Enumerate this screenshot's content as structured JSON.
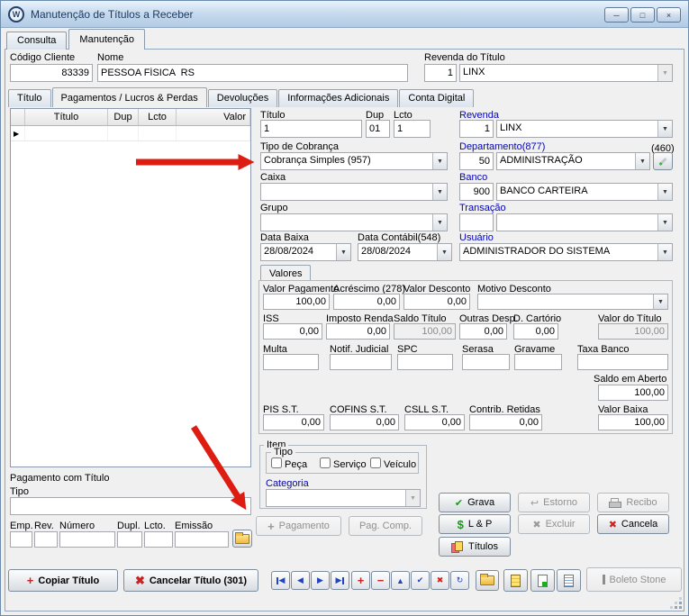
{
  "window": {
    "title": "Manutenção de Títulos a Receber"
  },
  "icons": {
    "app": "W",
    "minimize": "─",
    "maximize": "□",
    "close": "×",
    "dropdown": "▼",
    "row_marker": "▶",
    "check": "✔",
    "cross": "✖",
    "dollar": "$",
    "plus": "+",
    "minus": "−",
    "undo": "↩",
    "refresh": "↻",
    "edit_triangle": "▲",
    "nav_prev": "◀",
    "nav_next": "▶"
  },
  "main_tabs": {
    "consulta": "Consulta",
    "manutencao": "Manutenção"
  },
  "header": {
    "codigo_cliente": {
      "label": "Código Cliente",
      "value": "83339"
    },
    "nome": {
      "label": "Nome",
      "value": "PESSOA FÍSICA  RS"
    },
    "revenda_titulo": {
      "label": "Revenda do Título",
      "num": "1",
      "name": "LINX"
    }
  },
  "sub_tabs": {
    "titulo": "Título",
    "pagamentos": "Pagamentos / Lucros & Perdas",
    "devolucoes": "Devoluções",
    "informacoes": "Informações Adicionais",
    "conta_digital": "Conta Digital"
  },
  "grid": {
    "columns": {
      "titulo": "Título",
      "dup": "Dup",
      "lcto": "Lcto",
      "valor": "Valor"
    }
  },
  "detail": {
    "titulo": {
      "label": "Título",
      "value": "1"
    },
    "dup": {
      "label": "Dup",
      "value": "01"
    },
    "lcto": {
      "label": "Lcto",
      "value": "1"
    },
    "revenda": {
      "label": "Revenda",
      "num": "1",
      "name": "LINX"
    },
    "tipo_cobranca": {
      "label": "Tipo de Cobrança",
      "value": "Cobrança Simples (957)"
    },
    "departamento": {
      "label": "Departamento(877)",
      "note": "(460)",
      "num": "50",
      "name": "ADMINISTRAÇÃO"
    },
    "caixa": {
      "label": "Caixa",
      "value": ""
    },
    "banco": {
      "label": "Banco",
      "num": "900",
      "name": "BANCO CARTEIRA"
    },
    "grupo": {
      "label": "Grupo",
      "value": ""
    },
    "transacao": {
      "label": "Transação",
      "num": "",
      "name": ""
    },
    "data_baixa": {
      "label": "Data Baixa",
      "value": "28/08/2024"
    },
    "data_contabil": {
      "label": "Data Contábil(548)",
      "value": "28/08/2024"
    },
    "usuario": {
      "label": "Usuário",
      "value": "ADMINISTRADOR DO SISTEMA"
    }
  },
  "valores": {
    "tab": "Valores",
    "valor_pagamento": {
      "label": "Valor Pagamento",
      "value": "100,00"
    },
    "acrescimo": {
      "label": "Acréscimo (278)",
      "value": "0,00"
    },
    "valor_desconto": {
      "label": "Valor Desconto",
      "value": "0,00"
    },
    "motivo_desconto": {
      "label": "Motivo Desconto",
      "value": ""
    },
    "iss": {
      "label": "ISS",
      "value": "0,00"
    },
    "imposto_renda": {
      "label": "Imposto Renda",
      "value": "0,00"
    },
    "saldo_titulo": {
      "label": "Saldo Título",
      "value": "100,00"
    },
    "outras_desp": {
      "label": "Outras Desp.",
      "value": "0,00"
    },
    "d_cartorio": {
      "label": "D. Cartório",
      "value": "0,00"
    },
    "valor_do_titulo": {
      "label": "Valor do Título",
      "value": "100,00"
    },
    "multa": {
      "label": "Multa",
      "value": ""
    },
    "notif_judicial": {
      "label": "Notif. Judicial",
      "value": ""
    },
    "spc": {
      "label": "SPC",
      "value": ""
    },
    "serasa": {
      "label": "Serasa",
      "value": ""
    },
    "gravame": {
      "label": "Gravame",
      "value": ""
    },
    "taxa_banco": {
      "label": "Taxa Banco",
      "value": ""
    },
    "saldo_em_aberto": {
      "label": "Saldo em Aberto",
      "value": "100,00"
    },
    "pis_st": {
      "label": "PIS S.T.",
      "value": "0,00"
    },
    "cofins_st": {
      "label": "COFINS S.T.",
      "value": "0,00"
    },
    "csll_st": {
      "label": "CSLL S.T.",
      "value": "0,00"
    },
    "contrib_retidas": {
      "label": "Contrib. Retidas",
      "value": "0,00"
    },
    "valor_baixa": {
      "label": "Valor Baixa",
      "value": "100,00"
    }
  },
  "item": {
    "label": "Item",
    "tipo_label": "Tipo",
    "peca": "Peça",
    "servico": "Serviço",
    "veiculo": "Veículo",
    "categoria_label": "Categoria",
    "categoria_value": ""
  },
  "pagamento_com_titulo": {
    "label": "Pagamento com Título",
    "tipo_label": "Tipo",
    "tipo_value": "",
    "emp": "Emp.",
    "rev": "Rev.",
    "numero": "Número",
    "dupl": "Dupl.",
    "lcto": "Lcto.",
    "emissao": "Emissão"
  },
  "buttons": {
    "grava": "Grava",
    "estorno": "Estorno",
    "recibo": "Recibo",
    "lp": "L & P",
    "excluir": "Excluir",
    "cancela": "Cancela",
    "titulos": "Títulos",
    "pagamento": "Pagamento",
    "pag_comp": "Pag. Comp.",
    "copiar_titulo": "Copiar Título",
    "cancelar_titulo": "Cancelar Título (301)",
    "boleto_stone": "Boleto Stone"
  }
}
